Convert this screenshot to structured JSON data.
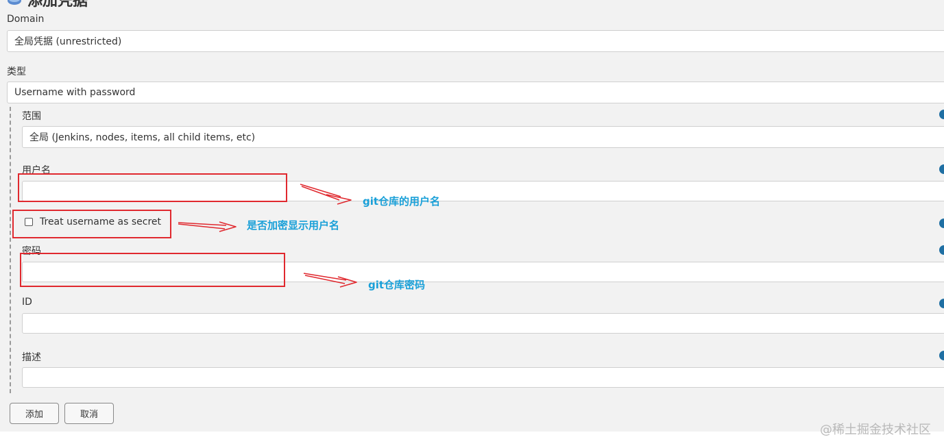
{
  "page": {
    "title": "添加凭据"
  },
  "form": {
    "domain": {
      "label": "Domain",
      "value": "全局凭据 (unrestricted)"
    },
    "kind": {
      "label": "类型",
      "value": "Username with password"
    },
    "scope": {
      "label": "范围",
      "value": "全局 (Jenkins, nodes, items, all child items, etc)"
    },
    "username": {
      "label": "用户名",
      "value": ""
    },
    "treat_secret": {
      "label": "Treat username as secret",
      "checked": false
    },
    "password": {
      "label": "密码",
      "value": ""
    },
    "id": {
      "label": "ID",
      "value": ""
    },
    "description": {
      "label": "描述",
      "value": ""
    }
  },
  "buttons": {
    "add": "添加",
    "cancel": "取消"
  },
  "annotations": {
    "username_note": "git仓库的用户名",
    "secret_note": "是否加密显示用户名",
    "password_note": "git仓库密码",
    "color": "#1aa0d8",
    "box_color": "#e0282e"
  },
  "watermark": "@稀土掘金技术社区",
  "icons": {
    "title_icon": "credentials-key-icon",
    "help": "help-icon"
  }
}
